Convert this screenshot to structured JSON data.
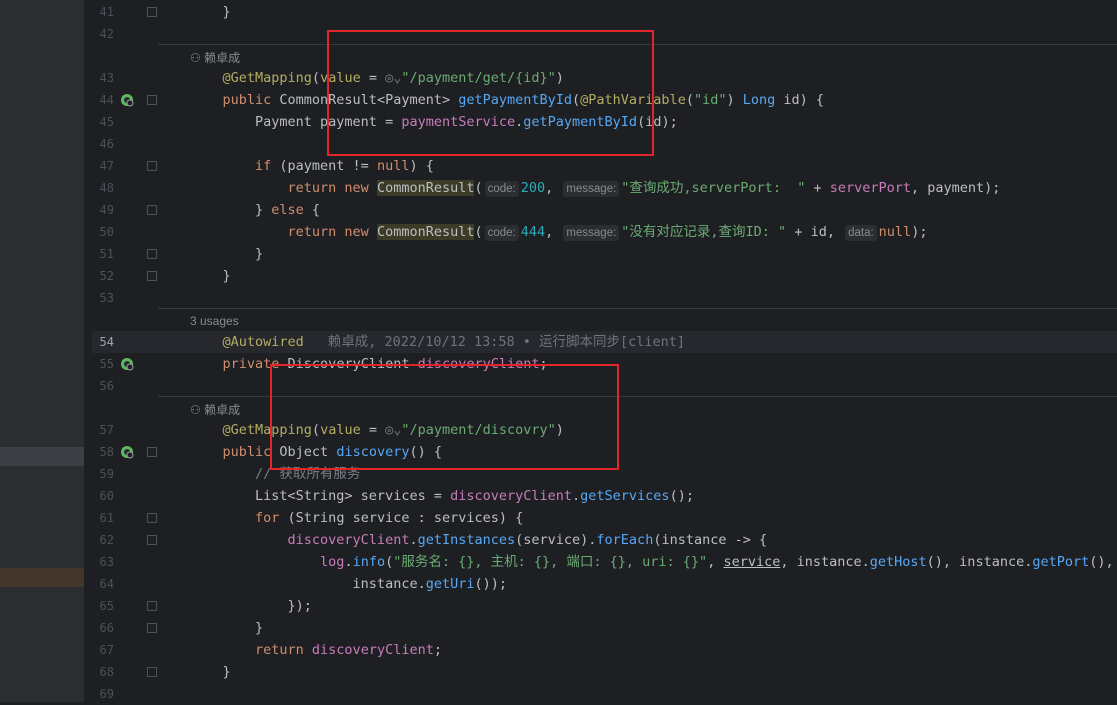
{
  "author_hint": "赖卓成",
  "usages_hint": "3 usages",
  "blame": "赖卓成, 2022/10/12 13:58 • 运行脚本同步[client]",
  "lines": [
    {
      "n": "41",
      "tokens": [
        {
          "t": "    }",
          "c": ""
        }
      ]
    },
    {
      "n": "42",
      "tokens": []
    },
    {
      "n": "43",
      "tokens": [
        {
          "t": "    @GetMapping",
          "c": "an"
        },
        {
          "t": "(",
          "c": ""
        },
        {
          "t": "value",
          "c": "an"
        },
        {
          "t": " = ",
          "c": ""
        },
        {
          "t": "◎⌄",
          "c": "cm"
        },
        {
          "t": "\"/payment/get/{id}\"",
          "c": "st"
        },
        {
          "t": ")",
          "c": ""
        }
      ]
    },
    {
      "n": "44",
      "tokens": [
        {
          "t": "    public ",
          "c": "kw"
        },
        {
          "t": "CommonResult<Payment> ",
          "c": ""
        },
        {
          "t": "getPaymentById",
          "c": "fn"
        },
        {
          "t": "(",
          "c": ""
        },
        {
          "t": "@PathVariable",
          "c": "an"
        },
        {
          "t": "(",
          "c": ""
        },
        {
          "t": "\"id\"",
          "c": "st"
        },
        {
          "t": ") ",
          "c": ""
        },
        {
          "t": "Long ",
          "c": "fn"
        },
        {
          "t": "id) {",
          "c": ""
        }
      ]
    },
    {
      "n": "45",
      "tokens": [
        {
          "t": "        Payment payment = ",
          "c": ""
        },
        {
          "t": "paymentService",
          "c": "fld"
        },
        {
          "t": ".",
          "c": ""
        },
        {
          "t": "getPaymentById",
          "c": "fn"
        },
        {
          "t": "(id);",
          "c": ""
        }
      ]
    },
    {
      "n": "46",
      "tokens": []
    },
    {
      "n": "47",
      "tokens": [
        {
          "t": "        if ",
          "c": "kw"
        },
        {
          "t": "(payment != ",
          "c": ""
        },
        {
          "t": "null",
          "c": "kw"
        },
        {
          "t": ") {",
          "c": ""
        }
      ]
    },
    {
      "n": "48",
      "tokens": [
        {
          "t": "            return new ",
          "c": "kw"
        },
        {
          "t": "CommonResult",
          "c": "hl-cls"
        },
        {
          "t": "(",
          "c": ""
        },
        {
          "t": "code:",
          "c": "hint"
        },
        {
          "t": "200",
          "c": "num"
        },
        {
          "t": ", ",
          "c": ""
        },
        {
          "t": "message:",
          "c": "hint"
        },
        {
          "t": "\"查询成功,serverPort:  \"",
          "c": "st"
        },
        {
          "t": " + ",
          "c": ""
        },
        {
          "t": "serverPort",
          "c": "fld"
        },
        {
          "t": ", payment);",
          "c": ""
        }
      ]
    },
    {
      "n": "49",
      "tokens": [
        {
          "t": "        } ",
          "c": ""
        },
        {
          "t": "else ",
          "c": "kw"
        },
        {
          "t": "{",
          "c": ""
        }
      ]
    },
    {
      "n": "50",
      "tokens": [
        {
          "t": "            return new ",
          "c": "kw"
        },
        {
          "t": "CommonResult",
          "c": "hl-cls"
        },
        {
          "t": "(",
          "c": ""
        },
        {
          "t": "code:",
          "c": "hint"
        },
        {
          "t": "444",
          "c": "num"
        },
        {
          "t": ", ",
          "c": ""
        },
        {
          "t": "message:",
          "c": "hint"
        },
        {
          "t": "\"没有对应记录,查询ID: \"",
          "c": "st"
        },
        {
          "t": " + id, ",
          "c": ""
        },
        {
          "t": "data:",
          "c": "hint"
        },
        {
          "t": "null",
          "c": "kw"
        },
        {
          "t": ");",
          "c": ""
        }
      ]
    },
    {
      "n": "51",
      "tokens": [
        {
          "t": "        }",
          "c": ""
        }
      ]
    },
    {
      "n": "52",
      "tokens": [
        {
          "t": "    }",
          "c": ""
        }
      ]
    },
    {
      "n": "53",
      "tokens": []
    },
    {
      "n": "54",
      "tokens": [
        {
          "t": "    @Autowired",
          "c": "an"
        },
        {
          "t": "blame",
          "c": "blame"
        }
      ]
    },
    {
      "n": "55",
      "tokens": [
        {
          "t": "    private ",
          "c": "kw"
        },
        {
          "t": "DiscoveryClient ",
          "c": ""
        },
        {
          "t": "discoveryClient",
          "c": "fld"
        },
        {
          "t": ";",
          "c": ""
        }
      ]
    },
    {
      "n": "56",
      "tokens": []
    },
    {
      "n": "57",
      "tokens": [
        {
          "t": "    @GetMapping",
          "c": "an"
        },
        {
          "t": "(",
          "c": ""
        },
        {
          "t": "value",
          "c": "an"
        },
        {
          "t": " = ",
          "c": ""
        },
        {
          "t": "◎⌄",
          "c": "cm"
        },
        {
          "t": "\"/payment/discovry\"",
          "c": "st"
        },
        {
          "t": ")",
          "c": ""
        }
      ]
    },
    {
      "n": "58",
      "tokens": [
        {
          "t": "    public ",
          "c": "kw"
        },
        {
          "t": "Object ",
          "c": ""
        },
        {
          "t": "discovery",
          "c": "fn"
        },
        {
          "t": "() {",
          "c": ""
        }
      ]
    },
    {
      "n": "59",
      "tokens": [
        {
          "t": "        // 获取所有服务",
          "c": "cm"
        }
      ]
    },
    {
      "n": "60",
      "tokens": [
        {
          "t": "        List<String> services = ",
          "c": ""
        },
        {
          "t": "discoveryClient",
          "c": "fld"
        },
        {
          "t": ".",
          "c": ""
        },
        {
          "t": "getServices",
          "c": "fn"
        },
        {
          "t": "();",
          "c": ""
        }
      ]
    },
    {
      "n": "61",
      "tokens": [
        {
          "t": "        for ",
          "c": "kw"
        },
        {
          "t": "(String service : services) {",
          "c": ""
        }
      ]
    },
    {
      "n": "62",
      "tokens": [
        {
          "t": "            discoveryClient",
          "c": "fld"
        },
        {
          "t": ".",
          "c": ""
        },
        {
          "t": "getInstances",
          "c": "fn"
        },
        {
          "t": "(service).",
          "c": ""
        },
        {
          "t": "forEach",
          "c": "fn"
        },
        {
          "t": "(instance -> {",
          "c": ""
        }
      ]
    },
    {
      "n": "63",
      "tokens": [
        {
          "t": "                log",
          "c": "fld"
        },
        {
          "t": ".",
          "c": ""
        },
        {
          "t": "info",
          "c": "fn"
        },
        {
          "t": "(",
          "c": ""
        },
        {
          "t": "\"服务名: {}, 主机: {}, 端口: {}, uri: {}\"",
          "c": "st"
        },
        {
          "t": ", ",
          "c": ""
        },
        {
          "t": "service",
          "c": "ul"
        },
        {
          "t": ", instance.",
          "c": ""
        },
        {
          "t": "getHost",
          "c": "fn"
        },
        {
          "t": "(), instance.",
          "c": ""
        },
        {
          "t": "getPort",
          "c": "fn"
        },
        {
          "t": "(),",
          "c": ""
        }
      ]
    },
    {
      "n": "64",
      "tokens": [
        {
          "t": "                    instance.",
          "c": ""
        },
        {
          "t": "getUri",
          "c": "fn"
        },
        {
          "t": "());",
          "c": ""
        }
      ]
    },
    {
      "n": "65",
      "tokens": [
        {
          "t": "            });",
          "c": ""
        }
      ]
    },
    {
      "n": "66",
      "tokens": [
        {
          "t": "        }",
          "c": ""
        }
      ]
    },
    {
      "n": "67",
      "tokens": [
        {
          "t": "        return ",
          "c": "kw"
        },
        {
          "t": "discoveryClient",
          "c": "fld"
        },
        {
          "t": ";",
          "c": ""
        }
      ]
    },
    {
      "n": "68",
      "tokens": [
        {
          "t": "    }",
          "c": ""
        }
      ]
    },
    {
      "n": "69",
      "tokens": []
    }
  ]
}
